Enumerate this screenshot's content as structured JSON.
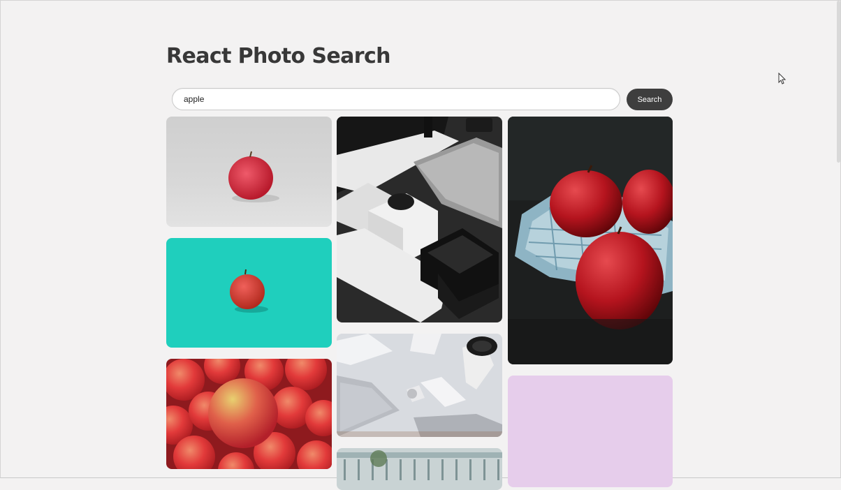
{
  "app": {
    "title": "React Photo Search"
  },
  "search": {
    "value": "apple",
    "button_label": "Search"
  },
  "results": [
    {
      "column": 1,
      "name": "photo-apple-gray"
    },
    {
      "column": 1,
      "name": "photo-apple-teal"
    },
    {
      "column": 1,
      "name": "photo-apple-pile"
    },
    {
      "column": 2,
      "name": "photo-apple-devices-boxes"
    },
    {
      "column": 2,
      "name": "photo-apple-desk-setup"
    },
    {
      "column": 2,
      "name": "photo-building"
    },
    {
      "column": 3,
      "name": "photo-red-apples-cloth"
    },
    {
      "column": 3,
      "name": "photo-loading-placeholder"
    }
  ],
  "colors": {
    "background": "#f3f2f2",
    "button": "#3e3e3e",
    "placeholder": "#e6cdeb"
  }
}
